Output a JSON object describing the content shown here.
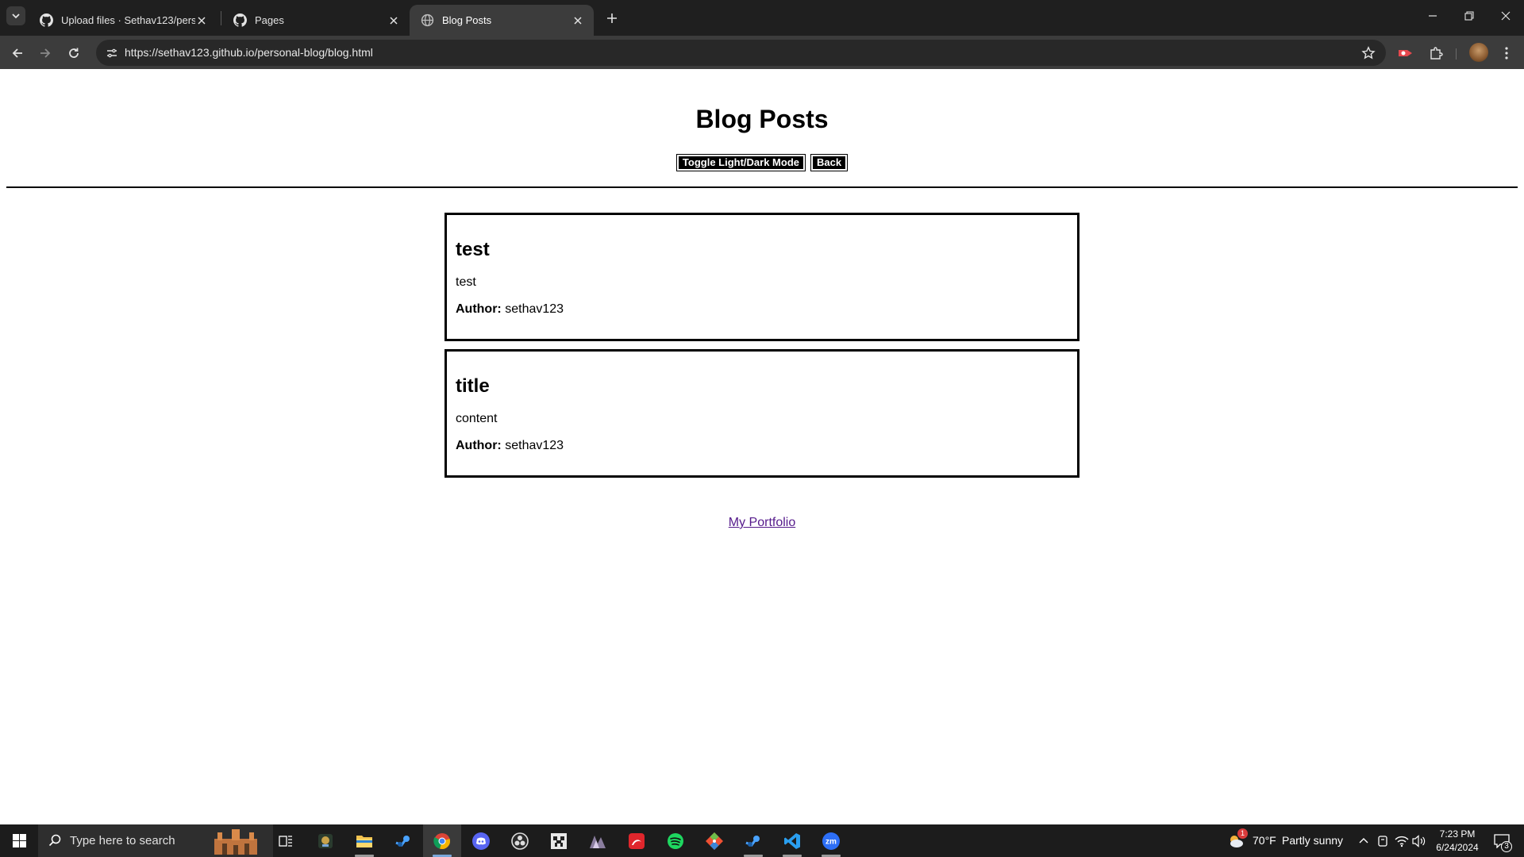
{
  "browser": {
    "tabs": [
      {
        "title": "Upload files · Sethav123/persona",
        "icon": "github-icon",
        "active": false
      },
      {
        "title": "Pages",
        "icon": "github-icon",
        "active": false
      },
      {
        "title": "Blog Posts",
        "icon": "globe-icon",
        "active": true
      }
    ],
    "url": "https://sethav123.github.io/personal-blog/blog.html"
  },
  "page": {
    "title": "Blog Posts",
    "buttons": {
      "toggle_label": "Toggle Light/Dark Mode",
      "back_label": "Back"
    },
    "posts": [
      {
        "title": "test",
        "content": "test",
        "author_label": "Author:",
        "author": "sethav123"
      },
      {
        "title": "title",
        "content": "content",
        "author_label": "Author:",
        "author": "sethav123"
      }
    ],
    "footer_link": "My Portfolio"
  },
  "taskbar": {
    "search_placeholder": "Type here to search",
    "apps": [
      "task-view",
      "game-app",
      "file-explorer",
      "steam",
      "chrome",
      "discord",
      "obs",
      "minecraft",
      "game-launcher",
      "adobe",
      "spotify",
      "git",
      "steam-2",
      "vscode",
      "zoom"
    ],
    "weather": {
      "temp": "70°F",
      "condition": "Partly sunny",
      "badge": "1"
    },
    "time": "7:23 PM",
    "date": "6/24/2024",
    "notifications": "3"
  },
  "colors": {
    "tabbar_bg": "#1f1f1f",
    "toolbar_bg": "#3c3c3c",
    "link_visited": "#551a8b",
    "taskbar_bg": "#1c1c1c"
  }
}
